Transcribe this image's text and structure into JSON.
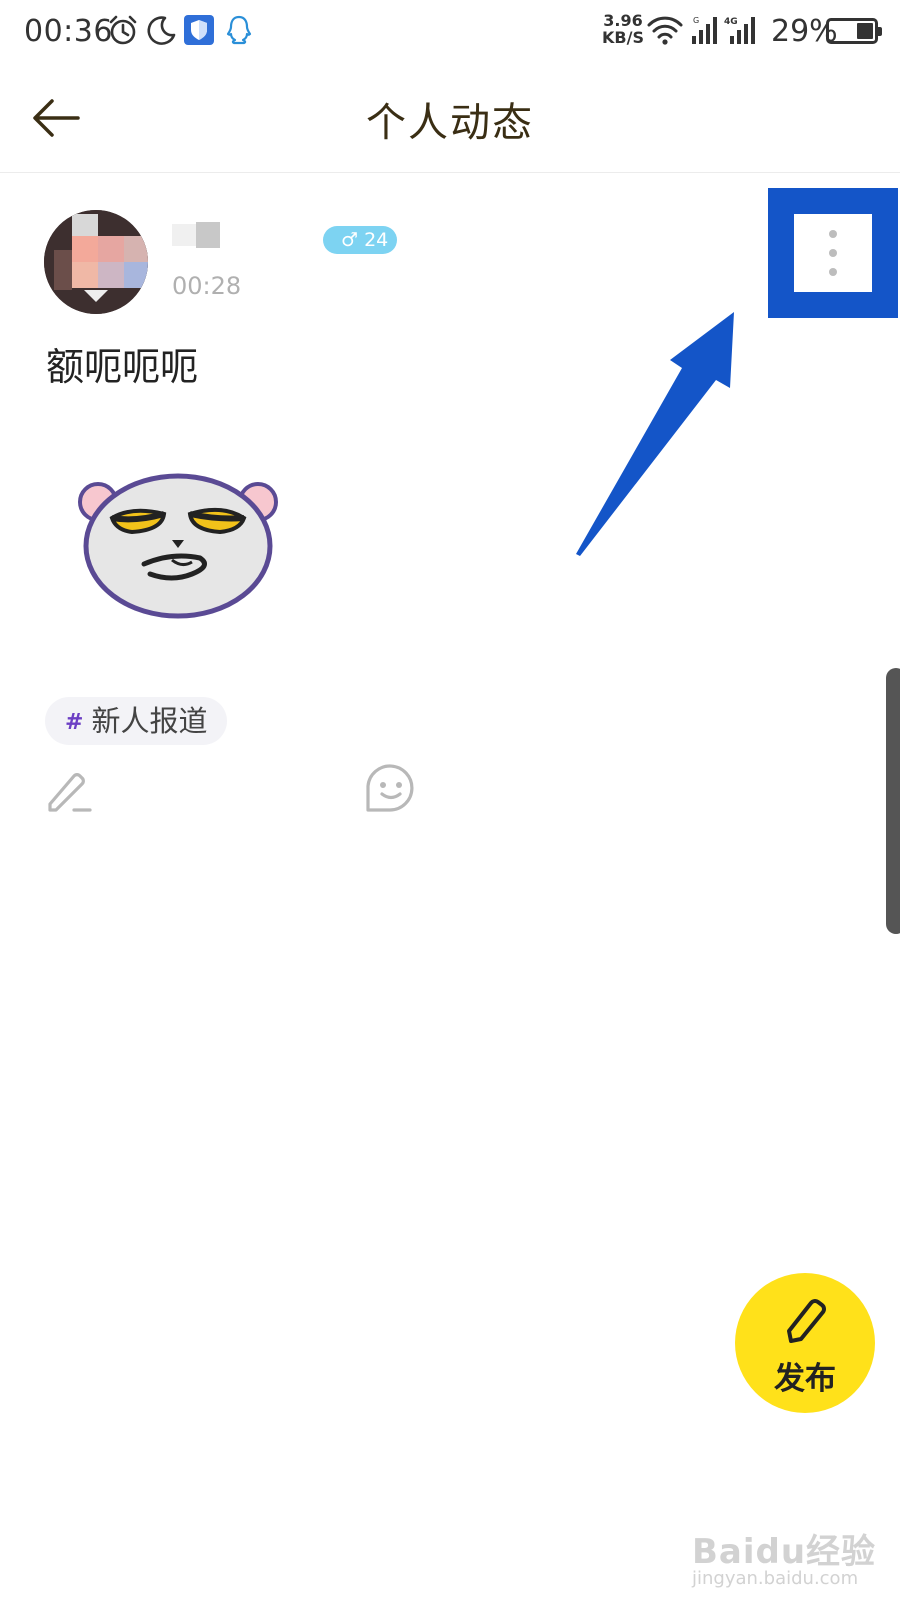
{
  "status_bar": {
    "time": "00:36",
    "net_speed_value": "3.96",
    "net_speed_unit": "KB/S",
    "battery_percent": "29%",
    "icons": [
      "alarm-icon",
      "moon-icon",
      "shield-icon",
      "qq-icon",
      "wifi-icon",
      "signal-icon",
      "signal-4g-icon",
      "battery-icon"
    ]
  },
  "header": {
    "title": "个人动态",
    "back_icon": "arrow-left-icon"
  },
  "post": {
    "gender_age": "24",
    "time": "00:28",
    "text": "额呃呃呃",
    "topic": "新人报道",
    "topic_hash": "#",
    "more_icon": "more-vertical-icon"
  },
  "fab": {
    "label": "发布"
  },
  "watermark": {
    "logo_text": "Baidu经验",
    "url": "jingyan.baidu.com"
  },
  "colors": {
    "fab_yellow": "#ffe11a",
    "highlight_blue": "#1455c8",
    "badge_blue": "#7dd3f2",
    "topic_hash_purple": "#6c3fc4"
  }
}
